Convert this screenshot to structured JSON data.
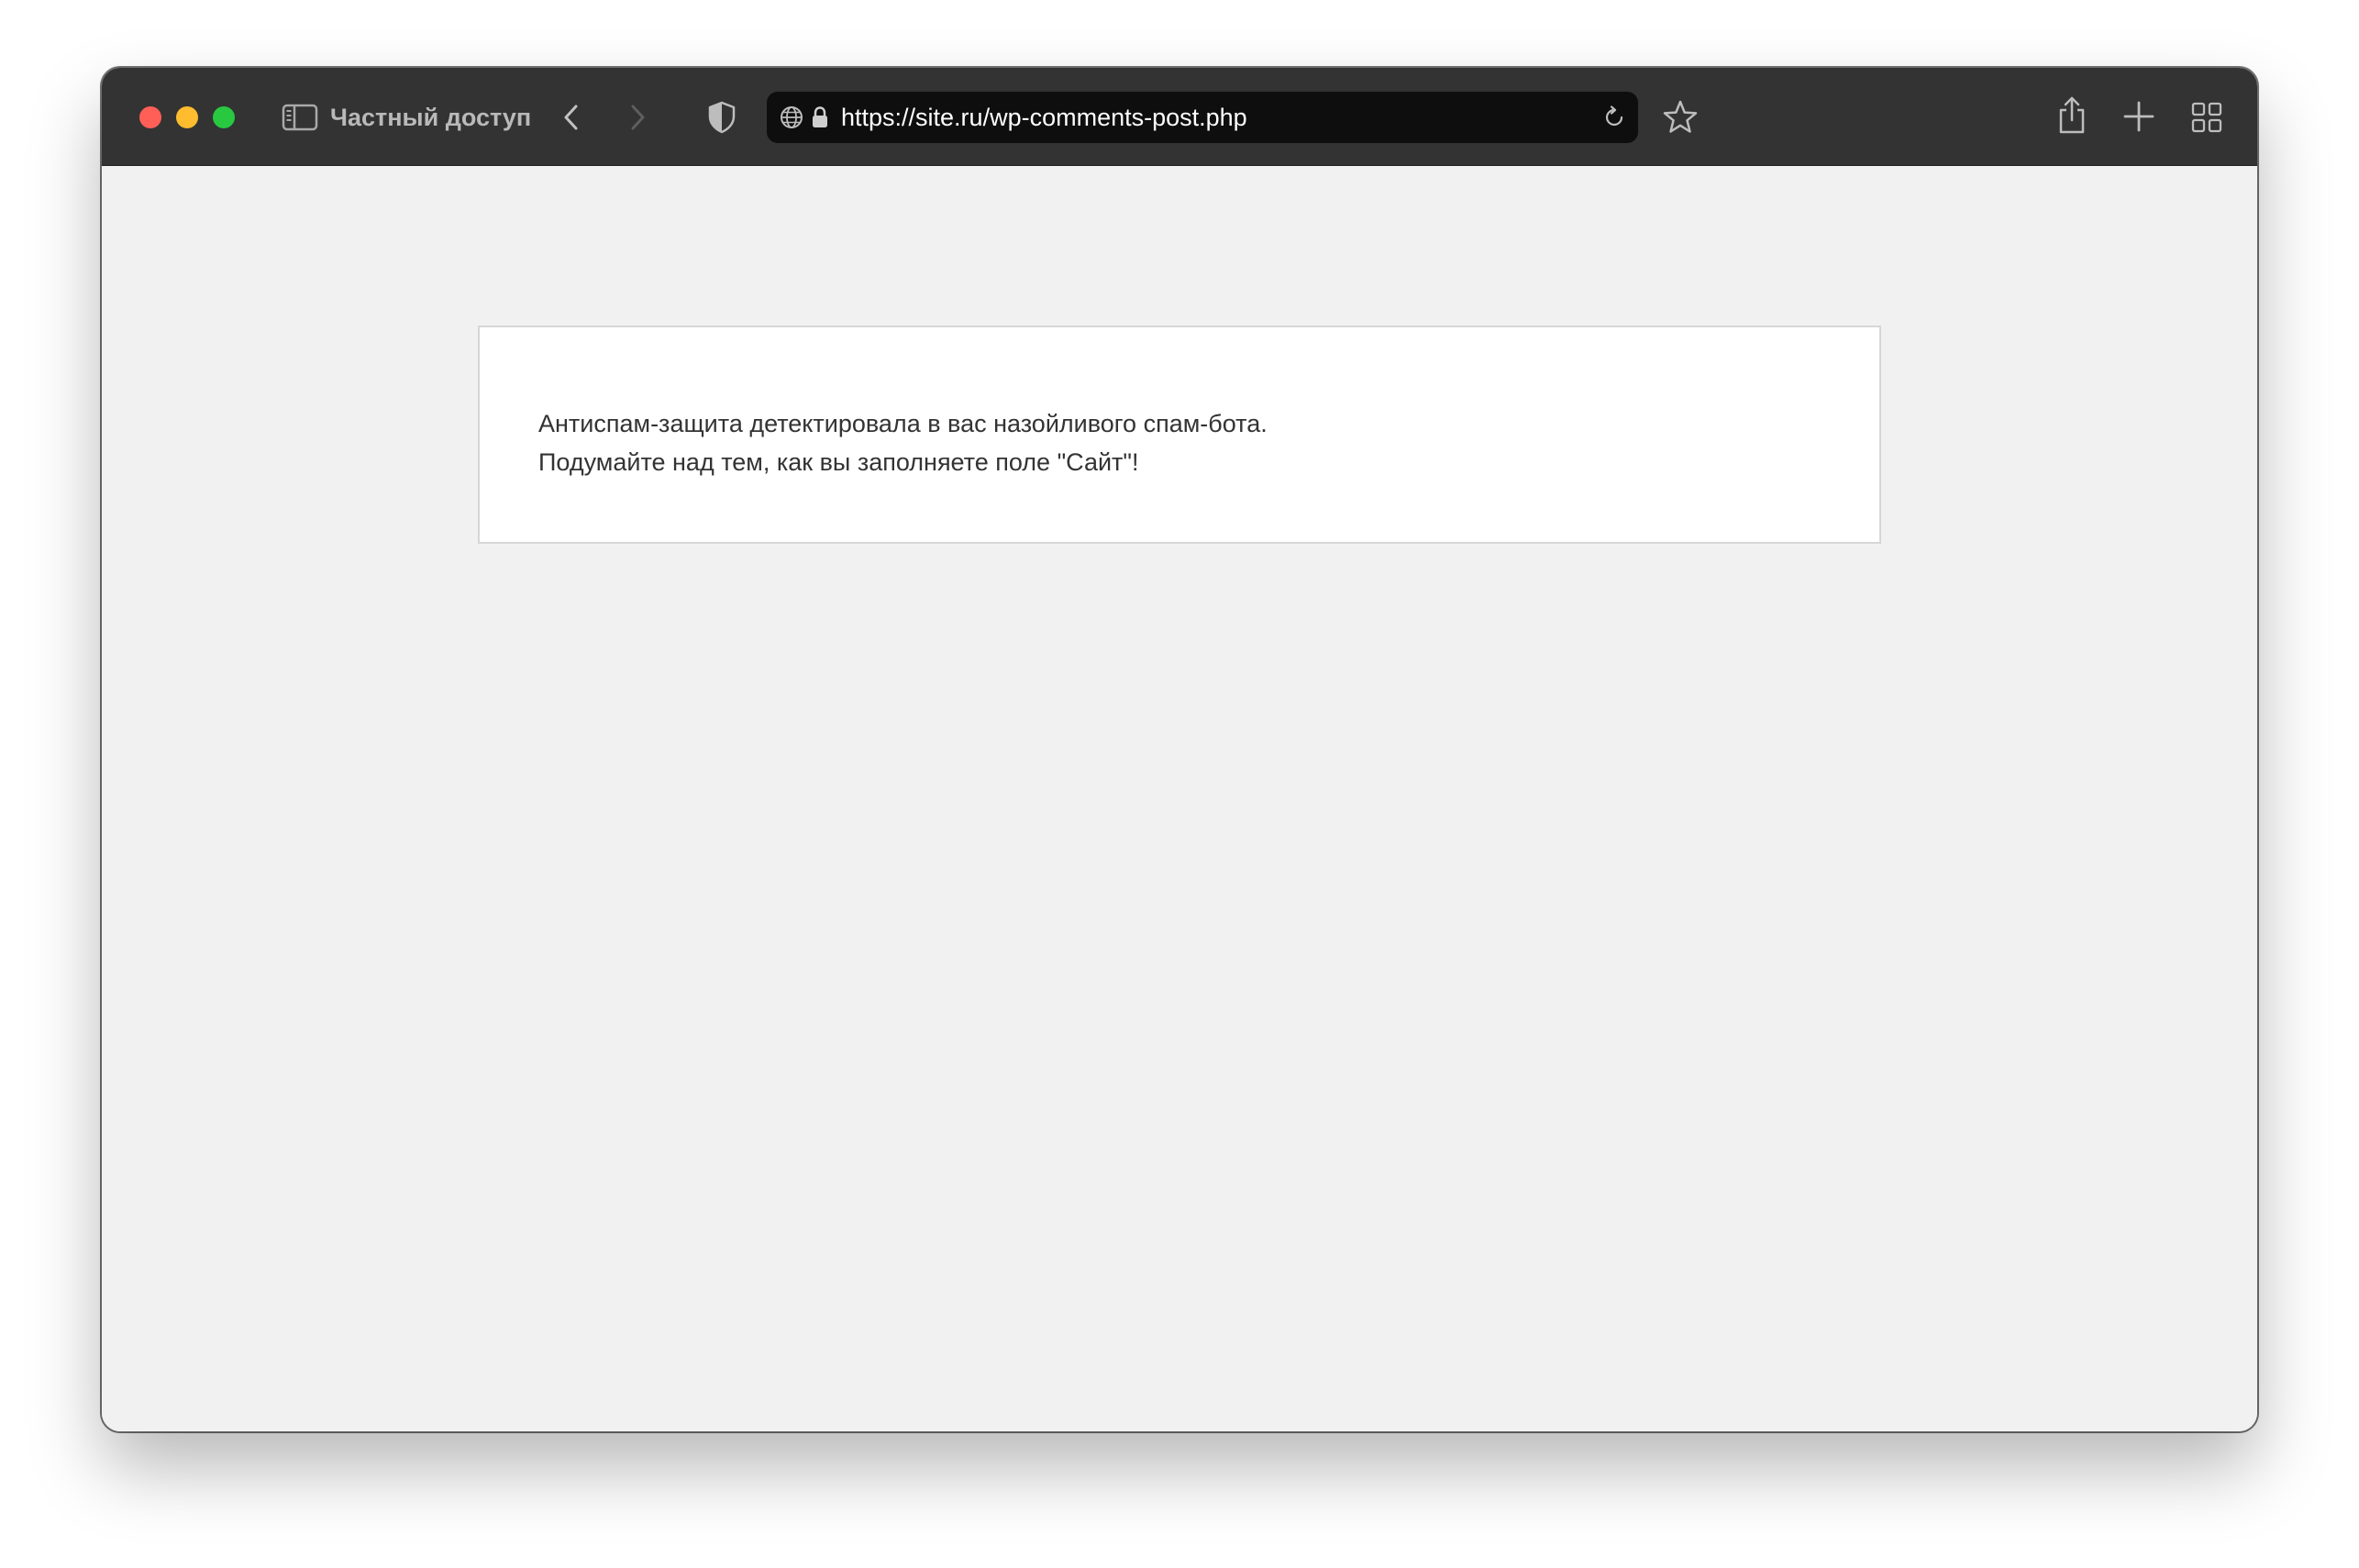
{
  "browser": {
    "private_label": "Частный доступ",
    "address_bar": {
      "url": "https://site.ru/wp-comments-post.php"
    },
    "icons": {
      "sidebar": "sidebar-toggle-icon",
      "back": "chevron-left-icon",
      "forward": "chevron-right-icon",
      "privacy": "shield-icon",
      "site": "globe-icon",
      "secure": "lock-icon",
      "reload": "reload-icon",
      "bookmark": "star-icon",
      "share": "share-icon",
      "new_tab": "plus-icon",
      "tab_overview": "grid-icon"
    },
    "colors": {
      "toolbar": "#333333",
      "close": "#ff5f57",
      "minimize": "#febc2e",
      "maximize": "#28c840"
    }
  },
  "page": {
    "message_line_1": "Антиспам-защита детектировала в вас назойливого спам-бота.",
    "message_line_2": "Подумайте над тем, как вы заполняете поле \"Сайт\"!"
  }
}
